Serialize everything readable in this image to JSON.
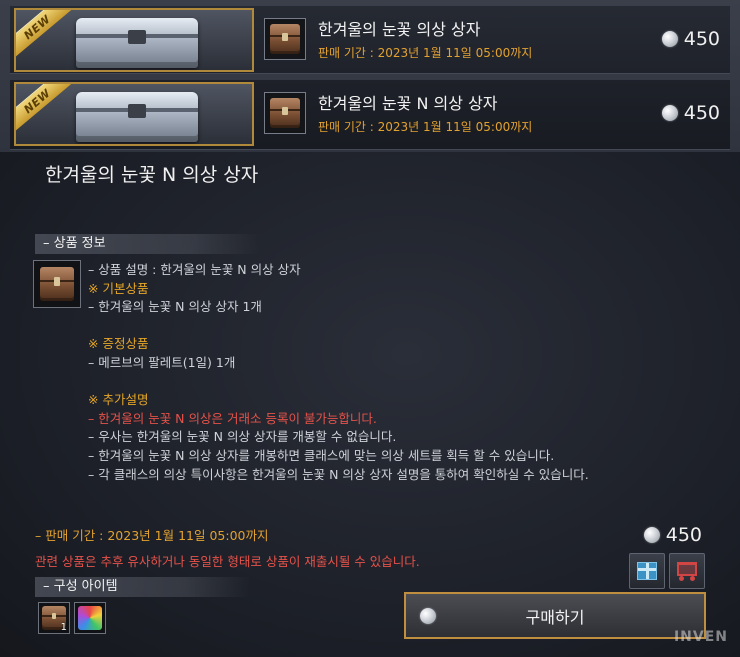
{
  "products": [
    {
      "badge": "NEW",
      "title": "한겨울의 눈꽃 의상 상자",
      "period": "판매 기간 : 2023년 1월 11일 05:00까지",
      "price": "450"
    },
    {
      "badge": "NEW",
      "title": "한겨울의 눈꽃 N 의상 상자",
      "period": "판매 기간 : 2023년 1월 11일 05:00까지",
      "price": "450"
    }
  ],
  "detail": {
    "title": "한겨울의 눈꽃 N 의상 상자",
    "info_header": "– 상품 정보",
    "description": {
      "line1": "– 상품 설명 : 한겨울의 눈꽃 N 의상 상자",
      "line2": "※ 기본상품",
      "line3": "– 한겨울의 눈꽃 N 의상 상자 1개",
      "line4": "※ 증정상품",
      "line5": "– 메르브의 팔레트(1일) 1개",
      "line6": "※ 추가설명",
      "line7": "– 한겨울의 눈꽃 N 의상은 거래소 등록이 불가능합니다.",
      "line8": "– 우사는 한겨울의 눈꽃 N 의상 상자를 개봉할 수 없습니다.",
      "line9": "– 한겨울의 눈꽃 N 의상 상자를 개봉하면 클래스에 맞는 의상 세트를 획득 할 수 있습니다.",
      "line10": "– 각 클래스의 의상 특이사항은 한겨울의 눈꽃 N 의상 상자 설명을 통하여 확인하실 수 있습니다."
    },
    "period": "– 판매 기간 : 2023년 1월 11일 05:00까지",
    "notice": "관련 상품은 추후 유사하거나 동일한 형태로 상품이 재출시될 수 있습니다.",
    "price": "450",
    "composition_header": "– 구성 아이템",
    "composition_items": [
      {
        "icon": "brown-chest-icon",
        "qty": "1"
      },
      {
        "icon": "palette-icon",
        "qty": ""
      }
    ],
    "buy_label": "구매하기",
    "gift_icon": "gift-icon",
    "cart_icon": "cart-icon"
  },
  "watermark": "INVEN",
  "colors": {
    "gold_text": "#e2a230",
    "red_text": "#e5524a",
    "banner_border": "#b08a3a",
    "buy_border": "#c08e3f"
  }
}
